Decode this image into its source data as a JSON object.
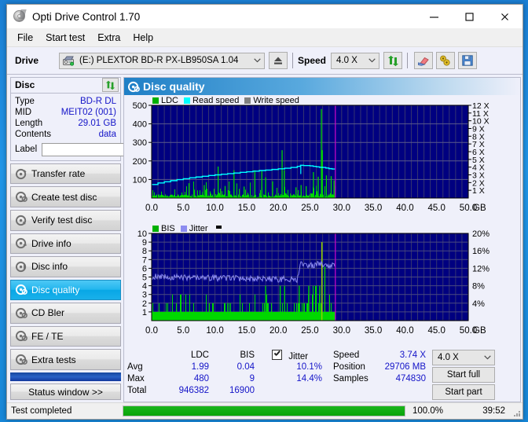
{
  "window": {
    "title": "Opti Drive Control 1.70",
    "icon": "disc-icon",
    "minimize": "minimize-icon",
    "maximize": "maximize-icon",
    "close": "close-icon"
  },
  "menu": {
    "items": [
      "File",
      "Start test",
      "Extra",
      "Help"
    ]
  },
  "toolbar": {
    "drive_label": "Drive",
    "drive_value": "(E:)  PLEXTOR BD-R  PX-LB950SA 1.04",
    "eject_icon": "eject-icon",
    "speed_label": "Speed",
    "speed_value": "4.0 X",
    "refresh_icon": "refresh-icon",
    "eraser_icon": "eraser-icon",
    "tools_icon": "tools-icon",
    "save_icon": "save-icon"
  },
  "disc": {
    "header": "Disc",
    "swap_icon": "refresh-icon",
    "fields": [
      {
        "key": "Type",
        "value": "BD-R DL"
      },
      {
        "key": "MID",
        "value": "MEIT02 (001)"
      },
      {
        "key": "Length",
        "value": "29.01 GB"
      },
      {
        "key": "Contents",
        "value": "data"
      }
    ],
    "label_key": "Label",
    "label_value": "",
    "label_placeholder": "",
    "label_button_icon": "disc-icon"
  },
  "nav": {
    "items": [
      {
        "label": "Transfer rate",
        "icon": "disc-test-icon",
        "selected": false
      },
      {
        "label": "Create test disc",
        "icon": "disc-test-icon",
        "selected": false
      },
      {
        "label": "Verify test disc",
        "icon": "disc-test-icon",
        "selected": false
      },
      {
        "label": "Drive info",
        "icon": "disc-test-icon",
        "selected": false
      },
      {
        "label": "Disc info",
        "icon": "disc-test-icon",
        "selected": false
      },
      {
        "label": "Disc quality",
        "icon": "disc-test-icon",
        "selected": true
      },
      {
        "label": "CD Bler",
        "icon": "disc-test-icon",
        "selected": false
      },
      {
        "label": "FE / TE",
        "icon": "disc-test-icon",
        "selected": false
      },
      {
        "label": "Extra tests",
        "icon": "disc-test-icon",
        "selected": false
      }
    ],
    "status_window": "Status window >>"
  },
  "panel": {
    "title": "Disc quality",
    "icon": "disc-test-icon"
  },
  "results": {
    "col_headers": {
      "ldc": "LDC",
      "bis": "BIS"
    },
    "rows": [
      {
        "label": "Avg",
        "ldc": "1.99",
        "bis": "0.04",
        "jitter": "10.1%"
      },
      {
        "label": "Max",
        "ldc": "480",
        "bis": "9",
        "jitter": "14.4%"
      },
      {
        "label": "Total",
        "ldc": "946382",
        "bis": "16900",
        "jitter": ""
      }
    ],
    "jitter_label": "Jitter",
    "jitter_checked": true,
    "speed_label": "Speed",
    "speed_value": "3.74 X",
    "position_label": "Position",
    "position_value": "29706 MB",
    "samples_label": "Samples",
    "samples_value": "474830",
    "speed_select": "4.0 X",
    "start_full": "Start full",
    "start_part": "Start part"
  },
  "statusbar": {
    "text": "Test completed",
    "percent": "100.0%",
    "percent_value": 100,
    "elapsed": "39:52",
    "grip_icon": "resize-grip-icon"
  },
  "colors": {
    "ldc_green": "#00d800",
    "read_speed_cyan": "#00ffff",
    "write_speed_gray": "#808080",
    "bis_green": "#00d800",
    "jitter_purple": "#8c8cf0",
    "plot_bg": "#000080",
    "grid": "#3a3a6e",
    "marker_magenta": "#cc00cc",
    "accent_blue": "#1414c8",
    "progress_green": "#0aa40a",
    "selected_nav": "#07a7e6"
  },
  "chart_data": [
    {
      "type": "line",
      "id": "ldc-chart",
      "title": "",
      "legend": [
        {
          "label": "LDC",
          "color": "#00d800"
        },
        {
          "label": "Read speed",
          "color": "#00ffff"
        },
        {
          "label": "Write speed",
          "color": "#808080"
        }
      ],
      "legend_position": "top-left",
      "grid": true,
      "xlabel": "GB",
      "xlim": [
        0,
        50
      ],
      "xticks": [
        "0.0",
        "5.0",
        "10.0",
        "15.0",
        "20.0",
        "25.0",
        "30.0",
        "35.0",
        "40.0",
        "45.0",
        "50.0"
      ],
      "ylabel_left": "LDC",
      "ylim": [
        0,
        500
      ],
      "yticks_left": [
        "100",
        "200",
        "300",
        "400",
        "500"
      ],
      "ylabel_right": "Speed",
      "ylim_right": [
        0,
        12
      ],
      "yticks_right": [
        "1 X",
        "2 X",
        "3 X",
        "4 X",
        "5 X",
        "6 X",
        "7 X",
        "8 X",
        "9 X",
        "10 X",
        "11 X",
        "12 X"
      ],
      "data_end_gb": 29.0,
      "marker_gb": 29.01,
      "series": [
        {
          "name": "Read speed",
          "color": "#00ffff",
          "axis": "right",
          "x": [
            0.0,
            1.0,
            2.0,
            3.0,
            4.0,
            5.0,
            6.0,
            7.0,
            8.0,
            9.0,
            10.0,
            11.0,
            12.0,
            13.0,
            14.0,
            15.0,
            16.0,
            17.0,
            18.0,
            19.0,
            20.0,
            21.0,
            22.0,
            23.0,
            23.5,
            24.0,
            25.0,
            25.5,
            26.0,
            26.5,
            27.0,
            27.5,
            28.0,
            28.5,
            29.0
          ],
          "values": [
            1.75,
            1.95,
            2.1,
            2.25,
            2.38,
            2.5,
            2.62,
            2.72,
            2.82,
            2.92,
            3.0,
            3.08,
            3.16,
            3.24,
            3.32,
            3.4,
            3.48,
            3.56,
            3.62,
            3.7,
            3.78,
            3.86,
            3.96,
            4.1,
            4.24,
            4.2,
            4.16,
            4.1,
            4.04,
            3.98,
            3.96,
            3.88,
            3.8,
            3.76,
            3.74
          ]
        },
        {
          "name": "LDC",
          "color": "#00d800",
          "axis": "left",
          "description": "dense green spike histogram from 0 to 29 GB, baseline ~8-20, frequent spikes 40-120, notable spikes at 10.5 (170), 13.0 (150), 16.3 (150), 17.5 (145), 18.0 (110), 20.6 (258), 20.9 (150), 22.8 (60), 25.6 (140), 26.3 (115), 26.8 (480), 26.9 (258), 27.6 (120), 28.4 (115)",
          "max": 480,
          "avg": 1.99
        }
      ]
    },
    {
      "type": "line",
      "id": "bis-jitter-chart",
      "title": "",
      "legend": [
        {
          "label": "BIS",
          "color": "#00d800"
        },
        {
          "label": "Jitter",
          "color": "#8c8cf0"
        }
      ],
      "legend_position": "top-left",
      "grid": true,
      "xlabel": "GB",
      "xlim": [
        0,
        50
      ],
      "xticks": [
        "0.0",
        "5.0",
        "10.0",
        "15.0",
        "20.0",
        "25.0",
        "30.0",
        "35.0",
        "40.0",
        "45.0",
        "50.0"
      ],
      "ylabel_left": "BIS",
      "ylim": [
        0,
        10
      ],
      "yticks_left": [
        "1",
        "2",
        "3",
        "4",
        "5",
        "6",
        "7",
        "8",
        "9",
        "10"
      ],
      "ylabel_right": "Jitter",
      "ylim_right": [
        0,
        20
      ],
      "yticks_right": [
        "4%",
        "8%",
        "12%",
        "16%",
        "20%"
      ],
      "data_end_gb": 29.0,
      "marker_gb": 29.01,
      "series": [
        {
          "name": "Jitter",
          "color": "#8c8cf0",
          "axis": "right",
          "description": "noisy band ~8.8%-12.4% (plot units 4.4-6.2) from 0 to 23 GB, then steps up to ~12.4%-14.4% (6.2-7.2) from 23.3 to 29 GB",
          "avg_pct": 10.1,
          "max_pct": 14.4
        },
        {
          "name": "BIS",
          "color": "#00d800",
          "axis": "left",
          "description": "solid green fill at 1 across 0-29 GB with frequent spikes to 2-3, denser block of 2-3 spikes from 23 to 29 GB, max spike 9 at 26.9 GB",
          "max": 9,
          "avg": 0.04,
          "total": 16900
        }
      ]
    }
  ]
}
